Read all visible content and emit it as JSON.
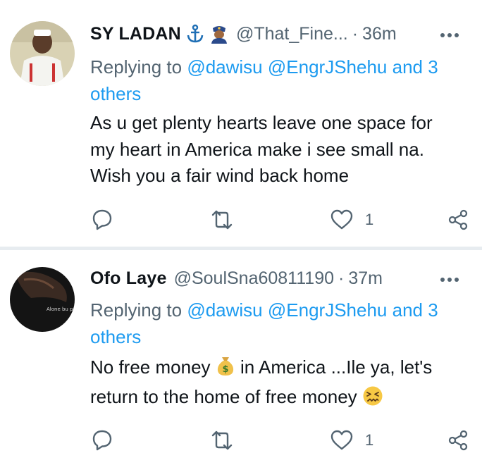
{
  "tweets": [
    {
      "name": "SY LADAN",
      "handle": "@That_Fine...",
      "separator": "·",
      "time": "36m",
      "reply_prefix": "Replying to",
      "mentions": [
        "@dawisu",
        "@EngrJShehu"
      ],
      "and_others": "and 3 others",
      "lines": [
        "As u get plenty hearts leave one space for",
        "my heart in America make i see small na.",
        "Wish you a fair wind back home"
      ],
      "likes": "1",
      "badge_icons": [
        "anchor-emoji",
        "police-officer-emoji"
      ]
    },
    {
      "name": "Ofo Laye",
      "handle": "@SoulSna60811190",
      "separator": "·",
      "time": "37m",
      "reply_prefix": "Replying to",
      "mentions": [
        "@dawisu",
        "@EngrJShehu"
      ],
      "and_others": "and 3 others",
      "line1_a": "No free money ",
      "line1_b": " in America ...Ile ya, let's",
      "line2": "return to the home of free money ",
      "likes": "1",
      "avatar_text": "Alone bu powerfu",
      "inline_emojis": [
        "money-bag-emoji",
        "confounded-face-emoji"
      ]
    }
  ],
  "colors": {
    "accent": "#1d9bf0",
    "secondary": "#536471",
    "text": "#0f1419",
    "divider": "#e7ecf0"
  }
}
